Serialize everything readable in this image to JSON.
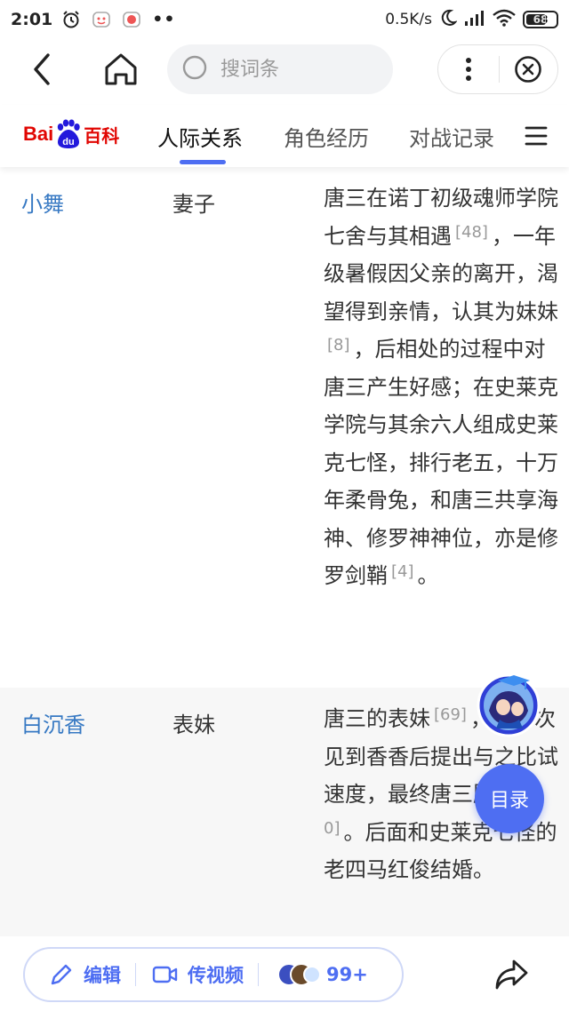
{
  "status_bar": {
    "time": "2:01",
    "dots": "••",
    "speed": "0.5K/s",
    "battery": "68"
  },
  "nav": {
    "search_placeholder": "搜词条"
  },
  "logo": {
    "text_bai": "Bai",
    "text_du": "du",
    "text_baike": "百科"
  },
  "tabs": [
    {
      "label": "人际关系",
      "active": true
    },
    {
      "label": "角色经历",
      "active": false
    },
    {
      "label": "对战记录",
      "active": false
    }
  ],
  "relations": [
    {
      "name": "小舞",
      "relation": "妻子",
      "desc_parts": [
        {
          "text": "唐三在诺丁初级魂师学院七舍与其相遇"
        },
        {
          "ref": "[48]"
        },
        {
          "text": "，一年级暑假因父亲的离开，渴望得到亲情，认其为妹妹"
        },
        {
          "ref": "[8]"
        },
        {
          "text": "，后相处的过程中对唐三产生好感；在史莱克学院与其余六人组成史莱克七怪，排行老五，十万年柔骨兔，和唐三共享海神、修罗神神位，亦是修罗剑鞘"
        },
        {
          "ref": "[4]"
        },
        {
          "text": "。"
        }
      ]
    },
    {
      "name": "白沉香",
      "relation": "表妹",
      "desc_parts": [
        {
          "text": "唐三的表妹"
        },
        {
          "ref": "[69]"
        },
        {
          "text": "，第一次见到香香后提出与之比试速度，最终唐三胜利"
        },
        {
          "ref": "[70]"
        },
        {
          "text": "。后面和史莱克七怪的老四马红俊结婚。"
        }
      ]
    }
  ],
  "floating": {
    "toc_label": "目录"
  },
  "bottom": {
    "edit_label": "编辑",
    "video_label": "传视频",
    "count_label": "99+"
  },
  "colors": {
    "accent": "#4e6ef2",
    "link": "#3779c3",
    "brand_red": "#e10602"
  }
}
